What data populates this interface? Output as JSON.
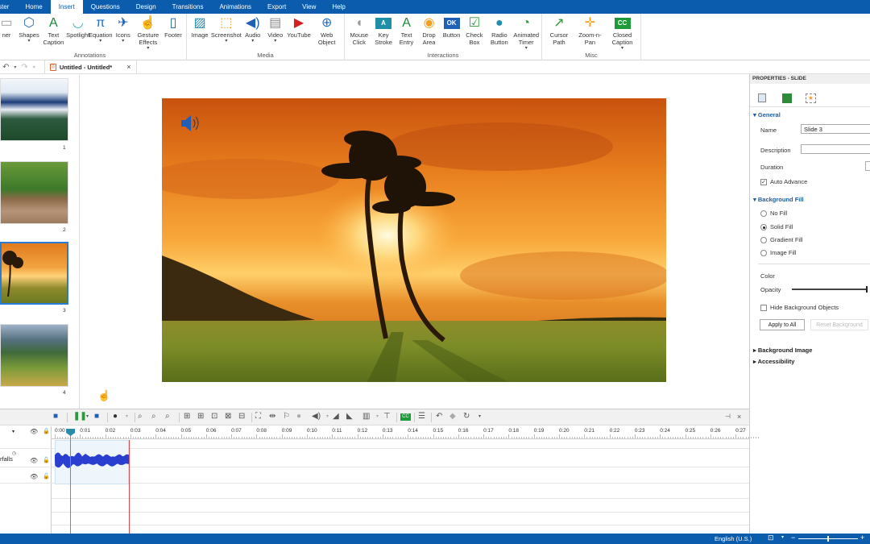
{
  "menu": {
    "tabs": [
      {
        "label": "ster"
      },
      {
        "label": "Home"
      },
      {
        "label": "Insert",
        "active": true
      },
      {
        "label": "Questions"
      },
      {
        "label": "Design"
      },
      {
        "label": "Transitions"
      },
      {
        "label": "Animations"
      },
      {
        "label": "Export"
      },
      {
        "label": "View"
      },
      {
        "label": "Help"
      }
    ]
  },
  "ribbon": {
    "annotations": {
      "label": "Annotations",
      "items": [
        {
          "label": "ner",
          "icon": "banner-icon"
        },
        {
          "label": "Shapes",
          "icon": "shapes-icon",
          "dropdown": true
        },
        {
          "label": "Text Caption",
          "icon": "text-caption-icon"
        },
        {
          "label": "Spotlight",
          "icon": "spotlight-icon"
        },
        {
          "label": "Equation",
          "icon": "pi-icon",
          "dropdown": true
        },
        {
          "label": "Icons",
          "icon": "airplane-icon",
          "dropdown": true
        },
        {
          "label": "Gesture Effects",
          "icon": "gesture-icon",
          "dropdown": true
        },
        {
          "label": "Footer",
          "icon": "footer-icon"
        }
      ]
    },
    "media": {
      "label": "Media",
      "items": [
        {
          "label": "Image",
          "icon": "image-icon"
        },
        {
          "label": "Screenshot",
          "icon": "screenshot-icon",
          "dropdown": true
        },
        {
          "label": "Audio",
          "icon": "audio-icon",
          "dropdown": true
        },
        {
          "label": "Video",
          "icon": "video-icon",
          "dropdown": true
        },
        {
          "label": "YouTube",
          "icon": "youtube-icon"
        },
        {
          "label": "Web Object",
          "icon": "globe-icon"
        }
      ]
    },
    "interactions": {
      "label": "Interactions",
      "items": [
        {
          "label": "Mouse Click",
          "icon": "mouse-icon"
        },
        {
          "label": "Key Stroke",
          "icon": "key-stroke-icon"
        },
        {
          "label": "Text Entry",
          "icon": "text-entry-icon"
        },
        {
          "label": "Drop Area",
          "icon": "drop-area-icon"
        },
        {
          "label": "Button",
          "icon": "ok-button-icon"
        },
        {
          "label": "Check Box",
          "icon": "checkbox-icon"
        },
        {
          "label": "Radio Button",
          "icon": "radio-icon"
        },
        {
          "label": "Animated Timer",
          "icon": "timer-icon",
          "dropdown": true
        }
      ]
    },
    "misc": {
      "label": "Misc",
      "items": [
        {
          "label": "Cursor Path",
          "icon": "cursor-path-icon"
        },
        {
          "label": "Zoom-n-Pan",
          "icon": "zoom-pan-icon"
        },
        {
          "label": "Closed Caption",
          "icon": "cc-icon",
          "dropdown": true
        }
      ]
    }
  },
  "document": {
    "tab_title": "Untitled - Untitled*"
  },
  "slides": [
    {
      "number": "1",
      "theme": "mountains-clouds"
    },
    {
      "number": "2",
      "theme": "palms-river"
    },
    {
      "number": "3",
      "theme": "sunset-palms",
      "selected": true
    },
    {
      "number": "4",
      "theme": "rice-terraces"
    }
  ],
  "properties": {
    "title": "PROPERTIES - SLIDE",
    "general": {
      "header": "General",
      "name_label": "Name",
      "name_value": "Slide 3",
      "description_label": "Description",
      "description_value": "",
      "duration_label": "Duration",
      "auto_advance_label": "Auto Advance",
      "auto_advance": true
    },
    "background_fill": {
      "header": "Background Fill",
      "options": [
        {
          "label": "No Fill",
          "selected": false
        },
        {
          "label": "Solid Fill",
          "selected": true
        },
        {
          "label": "Gradient Fill",
          "selected": false
        },
        {
          "label": "Image Fill",
          "selected": false
        }
      ],
      "color_label": "Color",
      "opacity_label": "Opacity",
      "opacity": 1.0,
      "hide_bg_label": "Hide Background Objects",
      "apply_all_label": "Apply to All",
      "reset_label": "Reset Background"
    },
    "background_image_header": "Background Image",
    "accessibility_header": "Accessibility"
  },
  "timeline": {
    "ticks": [
      "0:00",
      "0:01",
      "0:02",
      "0:03",
      "0:04",
      "0:05",
      "0:06",
      "0:07",
      "0:08",
      "0:09",
      "0:10",
      "0:11",
      "0:12",
      "0:13",
      "0:14",
      "0:15",
      "0:16",
      "0:17",
      "0:18",
      "0:19",
      "0:20",
      "0:21",
      "0:22",
      "0:23",
      "0:24",
      "0:25",
      "0:26",
      "0:27"
    ],
    "track_name": "rfalls",
    "playhead_seconds": 0.45,
    "slide_end_seconds": 2.95
  },
  "status": {
    "language": "English (U.S.)",
    "zoom_fraction": 0.5
  }
}
